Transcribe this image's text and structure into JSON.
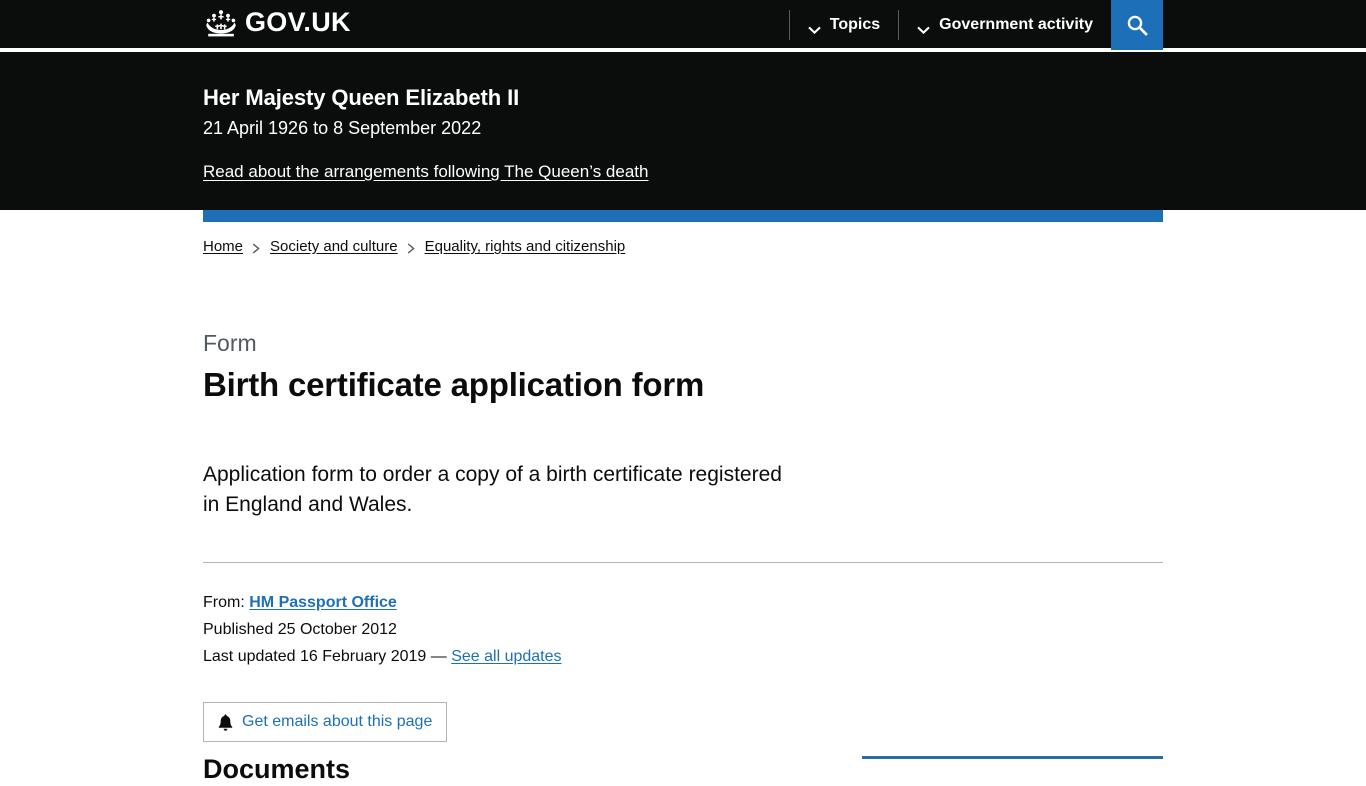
{
  "header": {
    "logo_text": "GOV.UK",
    "crown_icon": "crown-icon",
    "nav": [
      {
        "label": "Topics",
        "icon": "chevron-down-icon"
      },
      {
        "label": "Government activity",
        "icon": "chevron-down-icon"
      }
    ],
    "search_icon": "search-icon",
    "search_background": "#1d70b8"
  },
  "memorial": {
    "title": "Her Majesty Queen Elizabeth II",
    "dates": "21 April 1926 to 8 September 2022",
    "link": "Read about the arrangements following The Queen’s death",
    "background": "#0b0c0c"
  },
  "blue_bar_color": "#1d70b8",
  "breadcrumbs": [
    "Home",
    "Society and culture",
    "Equality, rights and citizenship"
  ],
  "main": {
    "doc_type": "Form",
    "title": "Birth certificate application form",
    "description": "Application form to order a copy of a birth certificate registered in England and Wales.",
    "meta": {
      "from_label": "From:",
      "from_org": "HM Passport Office",
      "published_label": "Published",
      "published_date": "25 October 2012",
      "last_updated_label": "Last updated",
      "last_updated_date": "16 February 2019",
      "updates_separator": "—",
      "updates_link": "See all updates"
    },
    "email_button": {
      "label": "Get emails about this page",
      "icon": "bell-icon"
    },
    "documents_heading": "Documents",
    "sidebar_rule_color": "#2b6c9c"
  }
}
